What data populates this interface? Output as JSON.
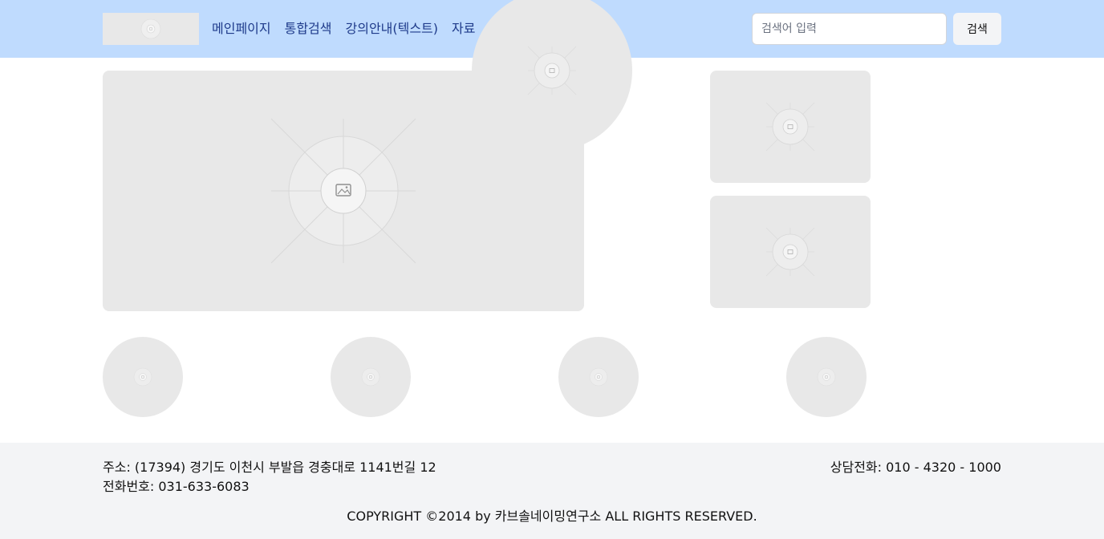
{
  "nav": {
    "items": [
      "메인페이지",
      "통합검색",
      "강의안내(텍스트)",
      "자료"
    ]
  },
  "search": {
    "placeholder": "검색어 입력",
    "button_label": "검색"
  },
  "footer": {
    "address": "주소: (17394) 경기도 이천시 부발읍 경충대로 1141번길 12",
    "phone": "전화번호: 031-633-6083",
    "consult": "상담전화: 010 - 4320 - 1000",
    "copyright": "COPYRIGHT ©2014 by 카브솔네이밍연구소 ALL RIGHTS RESERVED."
  },
  "colors": {
    "header_bg": "#bfdbfe",
    "nav_text": "#1e3a8a",
    "placeholder_bg": "#e8e8e8",
    "footer_bg": "#f3f4f6"
  },
  "icons": {
    "placeholder": "image-placeholder-icon"
  }
}
